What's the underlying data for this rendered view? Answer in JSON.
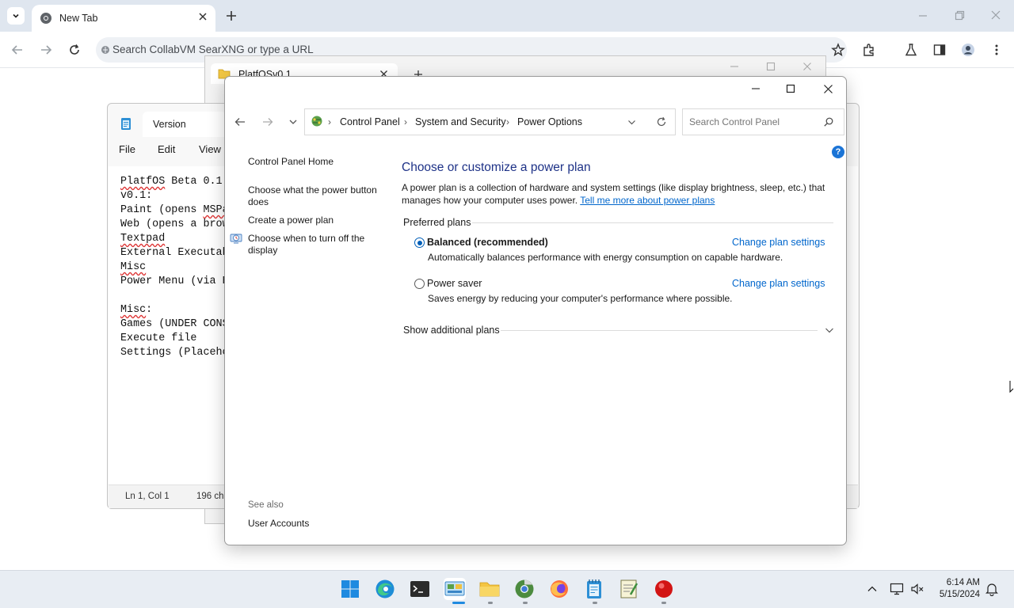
{
  "browser": {
    "tab_title": "New Tab",
    "omnibox_placeholder": "Search CollabVM SearXNG or type a URL"
  },
  "bg_window": {
    "tab_title": "PlatfOSv0.1"
  },
  "notepad": {
    "tab_title": "Version",
    "menu": [
      "File",
      "Edit",
      "View"
    ],
    "lines": [
      "PlatfOS Beta 0.1",
      "v0.1:",
      "Paint (opens MSPa",
      "Web (opens a brow",
      "Textpad",
      "External Executab",
      "Misc",
      "Power Menu (via E",
      "",
      "Misc:",
      "Games (UNDER CONS",
      "Execute file",
      "Settings (Placeho"
    ],
    "status_position": "Ln 1, Col 1",
    "status_chars": "196 ch"
  },
  "control_panel": {
    "breadcrumb": [
      "Control Panel",
      "System and Security",
      "Power Options"
    ],
    "search_placeholder": "Search Control Panel",
    "sidebar": {
      "home": "Control Panel Home",
      "items": [
        "Choose what the power button does",
        "Create a power plan",
        "Choose when to turn off the display"
      ],
      "see_also_label": "See also",
      "see_also_items": [
        "User Accounts"
      ]
    },
    "title": "Choose or customize a power plan",
    "description": "A power plan is a collection of hardware and system settings (like display brightness, sleep, etc.) that manages how your computer uses power.",
    "learn_more_link": "Tell me more about power plans",
    "preferred_plans_label": "Preferred plans",
    "plans": [
      {
        "name": "Balanced (recommended)",
        "description": "Automatically balances performance with energy consumption on capable hardware.",
        "selected": true,
        "change_link": "Change plan settings"
      },
      {
        "name": "Power saver",
        "description": "Saves energy by reducing your computer's performance where possible.",
        "selected": false,
        "change_link": "Change plan settings"
      }
    ],
    "additional_plans_label": "Show additional plans"
  },
  "taskbar": {
    "time": "6:14 AM",
    "date": "5/15/2024"
  },
  "colors": {
    "accent": "#005fb8",
    "link": "#0066cc",
    "title_blue": "#1e3287",
    "taskbar": "#e8edf3"
  }
}
